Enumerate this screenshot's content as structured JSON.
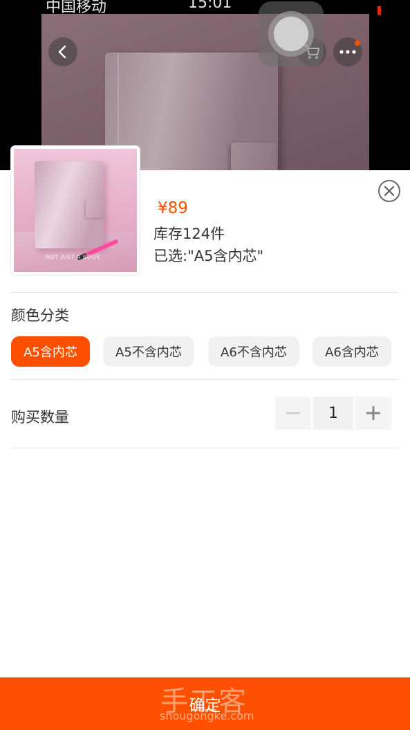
{
  "status_bar": {
    "carrier": "中国移动",
    "time": "15:01"
  },
  "nav": {
    "back_icon": "chevron-left-icon",
    "cart_icon": "cart-icon",
    "more_icon": "ellipsis-icon"
  },
  "product": {
    "price": "¥89",
    "stock": "库存124件",
    "selected": "已选:\"A5含内芯\"",
    "thumbnail_watermark": "NOT JUST A BOOK"
  },
  "color_section": {
    "title": "颜色分类",
    "options": [
      {
        "label": "A5含内芯",
        "selected": true
      },
      {
        "label": "A5不含内芯",
        "selected": false
      },
      {
        "label": "A6不含内芯",
        "selected": false
      },
      {
        "label": "A6含内芯",
        "selected": false
      }
    ]
  },
  "quantity_section": {
    "title": "购买数量",
    "value": "1"
  },
  "footer": {
    "confirm_label": "确定",
    "watermark_title": "手工客",
    "watermark_url": "shougongke.com"
  },
  "colors": {
    "accent": "#ff5000",
    "chip_bg": "#f1f1f1",
    "divider": "#e5e5e5"
  }
}
